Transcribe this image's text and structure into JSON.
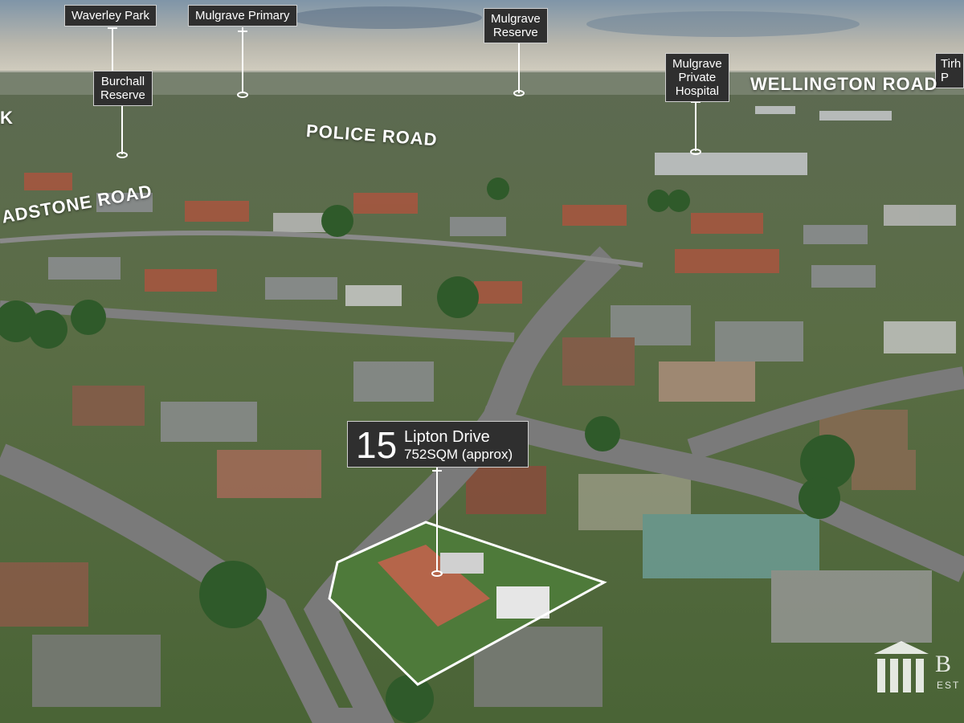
{
  "image": {
    "kind": "aerial-photo-with-annotations",
    "colors": {
      "sky_top": "#7f95a8",
      "sky_haze": "#d8d3c4",
      "foliage": "#4f6b3c",
      "roof_terracotta": "#b5654a",
      "road": "#7a7a7a",
      "label_bg": "#2f2f2f",
      "outline": "#ffffff"
    }
  },
  "landmarks": [
    {
      "id": "waverley-park",
      "label": "Waverley Park"
    },
    {
      "id": "mulgrave-primary",
      "label": "Mulgrave Primary"
    },
    {
      "id": "mulgrave-reserve",
      "label": "Mulgrave\nReserve"
    },
    {
      "id": "burchall-reserve",
      "label": "Burchall\nReserve"
    },
    {
      "id": "mulgrave-private-hospital",
      "label": "Mulgrave\nPrivate\nHospital"
    },
    {
      "id": "tirh",
      "label": "Tirh\nP"
    }
  ],
  "roads": [
    {
      "id": "wellington-road",
      "label": "WELLINGTON ROAD"
    },
    {
      "id": "police-road",
      "label": "POLICE ROAD"
    },
    {
      "id": "gladstone-road",
      "label": "ADSTONE ROAD"
    },
    {
      "id": "left-edge",
      "label": "K"
    }
  ],
  "property": {
    "number": "15",
    "street": "Lipton Drive",
    "area": "752SQM (approx)"
  },
  "watermark": {
    "text": "B",
    "sub": "EST"
  }
}
